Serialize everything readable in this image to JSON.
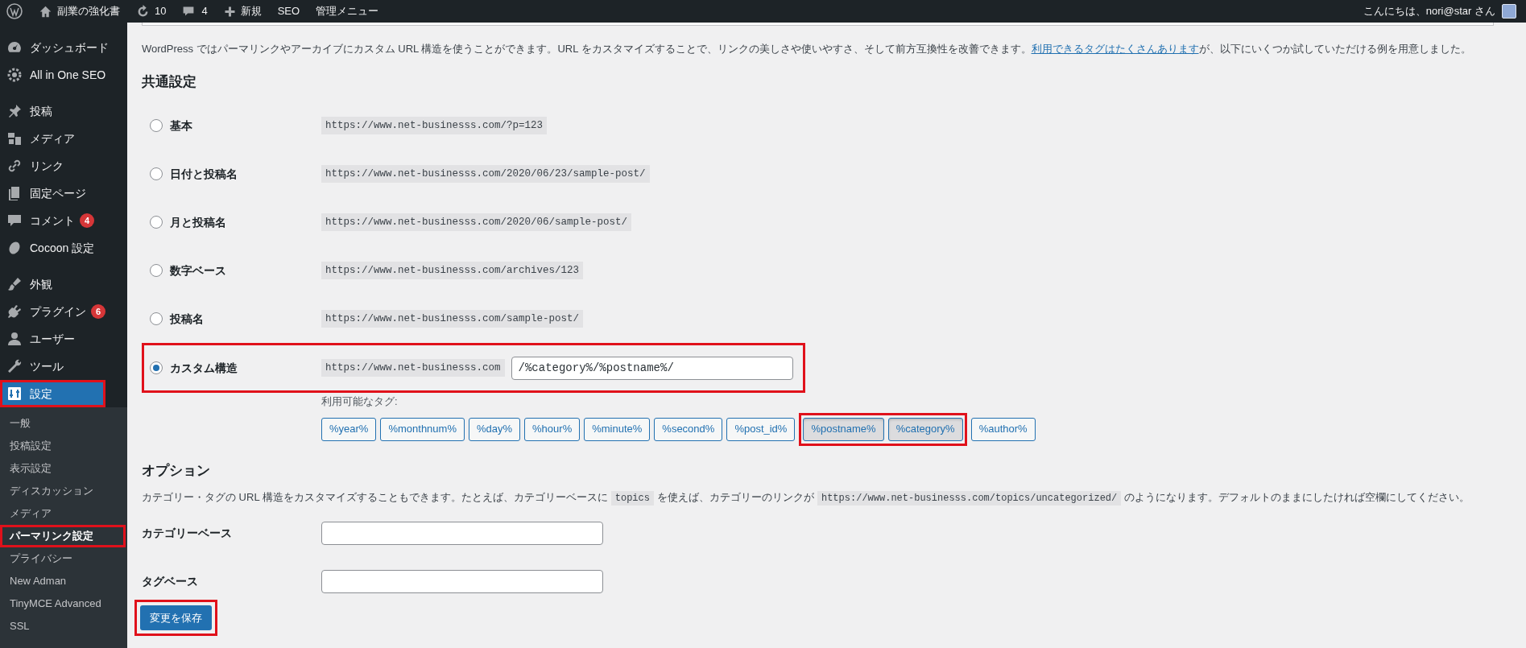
{
  "admin_bar": {
    "site_name": "副業の強化書",
    "updates": "10",
    "comments": "4",
    "new": "新規",
    "seo": "SEO",
    "admin_menu": "管理メニュー",
    "greeting": "こんにちは、nori@star さん"
  },
  "sidebar": {
    "items": [
      {
        "label": "ダッシュボード",
        "selected": false,
        "highlighted": false
      },
      {
        "label": "All in One SEO",
        "selected": false,
        "highlighted": false
      },
      {
        "label": "投稿",
        "selected": false,
        "highlighted": false
      },
      {
        "label": "メディア",
        "selected": false,
        "highlighted": false
      },
      {
        "label": "リンク",
        "selected": false,
        "highlighted": false
      },
      {
        "label": "固定ページ",
        "selected": false,
        "highlighted": false
      },
      {
        "label": "コメント",
        "badge": "4",
        "selected": false,
        "highlighted": false
      },
      {
        "label": "Cocoon 設定",
        "selected": false,
        "highlighted": false
      },
      {
        "label": "外観",
        "selected": false,
        "highlighted": false
      },
      {
        "label": "プラグイン",
        "badge": "6",
        "selected": false,
        "highlighted": false
      },
      {
        "label": "ユーザー",
        "selected": false,
        "highlighted": false
      },
      {
        "label": "ツール",
        "selected": false,
        "highlighted": false
      },
      {
        "label": "設定",
        "selected": true,
        "highlighted": true
      }
    ],
    "submenu": [
      {
        "label": "一般",
        "selected": false,
        "highlighted": false
      },
      {
        "label": "投稿設定",
        "selected": false,
        "highlighted": false
      },
      {
        "label": "表示設定",
        "selected": false,
        "highlighted": false
      },
      {
        "label": "ディスカッション",
        "selected": false,
        "highlighted": false
      },
      {
        "label": "メディア",
        "selected": false,
        "highlighted": false
      },
      {
        "label": "パーマリンク設定",
        "selected": true,
        "highlighted": true
      },
      {
        "label": "プライバシー",
        "selected": false,
        "highlighted": false
      },
      {
        "label": "New Adman",
        "selected": false,
        "highlighted": false
      },
      {
        "label": "TinyMCE Advanced",
        "selected": false,
        "highlighted": false
      },
      {
        "label": "SSL",
        "selected": false,
        "highlighted": false
      }
    ]
  },
  "intro": {
    "before": "WordPress ではパーマリンクやアーカイブにカスタム URL 構造を使うことができます。URL をカスタマイズすることで、リンクの美しさや使いやすさ、そして前方互換性を改善できます。",
    "link": "利用できるタグはたくさんあります",
    "after": "が、以下にいくつか試していただける例を用意しました。"
  },
  "common_heading": "共通設定",
  "options": [
    {
      "kind": "preset",
      "label": "基本",
      "url": "https://www.net-businesss.com/?p=123",
      "selected": false,
      "highlighted": false
    },
    {
      "kind": "preset",
      "label": "日付と投稿名",
      "url": "https://www.net-businesss.com/2020/06/23/sample-post/",
      "selected": false,
      "highlighted": false
    },
    {
      "kind": "preset",
      "label": "月と投稿名",
      "url": "https://www.net-businesss.com/2020/06/sample-post/",
      "selected": false,
      "highlighted": false
    },
    {
      "kind": "preset",
      "label": "数字ベース",
      "url": "https://www.net-businesss.com/archives/123",
      "selected": false,
      "highlighted": false
    },
    {
      "kind": "preset",
      "label": "投稿名",
      "url": "https://www.net-businesss.com/sample-post/",
      "selected": false,
      "highlighted": false
    },
    {
      "kind": "custom",
      "label": "カスタム構造",
      "url": "https://www.net-businesss.com",
      "value": "/%category%/%postname%/",
      "selected": true,
      "highlighted": true
    }
  ],
  "tags_label": "利用可能なタグ:",
  "tags": [
    {
      "label": "%year%",
      "selected": false,
      "highlighted": false
    },
    {
      "label": "%monthnum%",
      "selected": false,
      "highlighted": false
    },
    {
      "label": "%day%",
      "selected": false,
      "highlighted": false
    },
    {
      "label": "%hour%",
      "selected": false,
      "highlighted": false
    },
    {
      "label": "%minute%",
      "selected": false,
      "highlighted": false
    },
    {
      "label": "%second%",
      "selected": false,
      "highlighted": false
    },
    {
      "label": "%post_id%",
      "selected": false,
      "highlighted": false
    },
    {
      "label": "%postname%",
      "selected": true,
      "highlighted": true
    },
    {
      "label": "%category%",
      "selected": true,
      "highlighted": true
    },
    {
      "label": "%author%",
      "selected": false,
      "highlighted": false
    }
  ],
  "optional_heading": "オプション",
  "optional_desc": [
    {
      "kind": "text",
      "text": "カテゴリー・タグの URL 構造をカスタマイズすることもできます。たとえば、カテゴリーベースに"
    },
    {
      "kind": "code",
      "text": "topics"
    },
    {
      "kind": "text",
      "text": "を使えば、カテゴリーのリンクが"
    },
    {
      "kind": "code",
      "text": "https://www.net-businesss.com/topics/uncategorized/"
    },
    {
      "kind": "text",
      "text": "のようになります。デフォルトのままにしたければ空欄にしてください。"
    }
  ],
  "fields": [
    {
      "label": "カテゴリーベース"
    },
    {
      "label": "タグベース"
    }
  ],
  "save_button": {
    "label": "変更を保存",
    "highlighted": true
  }
}
